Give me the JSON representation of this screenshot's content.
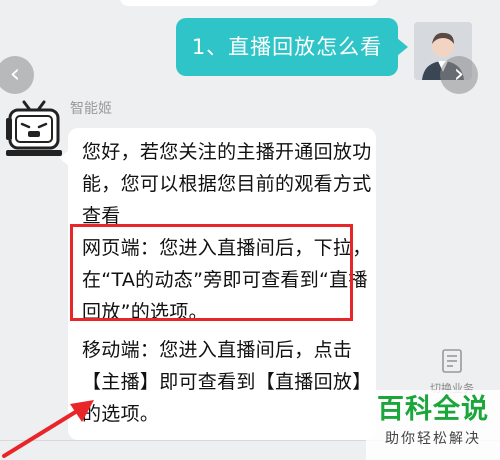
{
  "chat": {
    "user_message": "1、直播回放怎么看",
    "bot_name": "智能姬",
    "bot_paragraphs": [
      "您好，若您关注的主播开通回放功能，您可以根据您目前的观看方式查看",
      "网页端：您进入直播间后，下拉，在“TA的动态”旁即可查看到“直播回放”的选项。",
      "移动端：您进入直播间后，点击【主播】即可查看到【直播回放】的选项。"
    ]
  },
  "nav": {
    "prev_icon": "‹",
    "next_icon": "›"
  },
  "side": {
    "switch_label": "切换业务"
  },
  "brand": {
    "name": "百科全说",
    "slogan": "助你轻松解决"
  },
  "colors": {
    "user_bubble": "#2fc5c8",
    "highlight": "#e8262a",
    "brand": "#1aa63a"
  }
}
